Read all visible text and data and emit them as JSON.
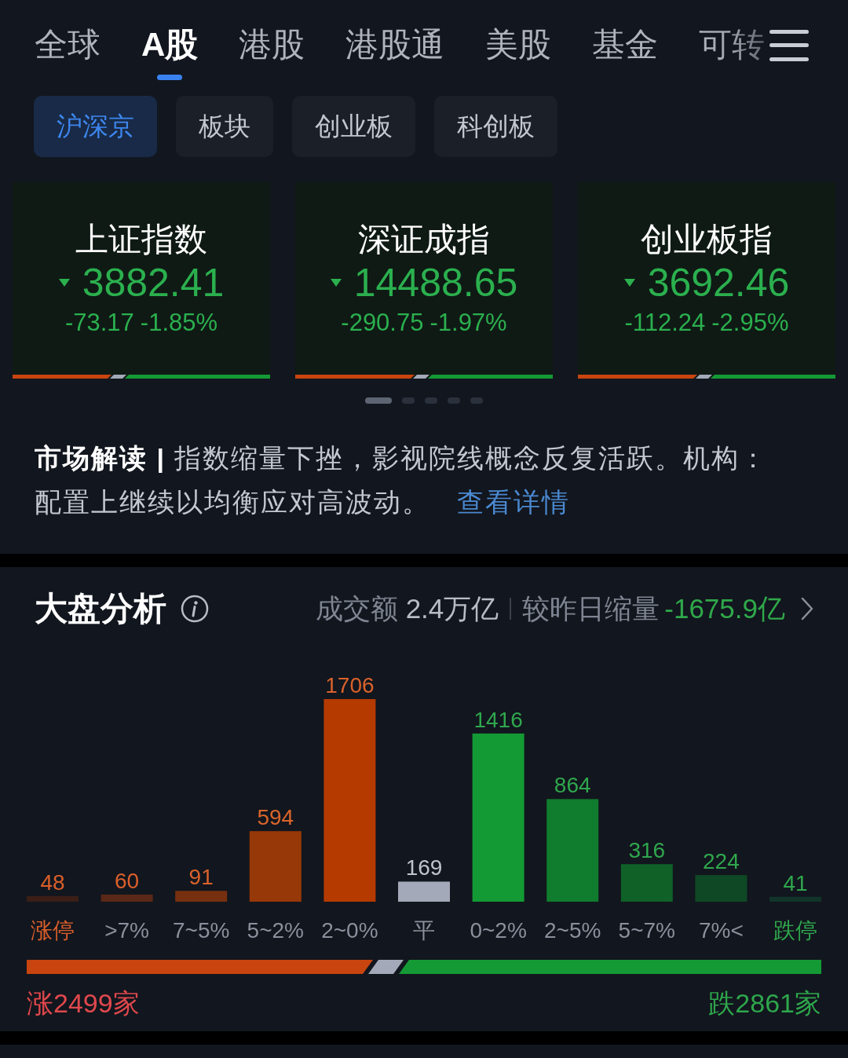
{
  "tabs": [
    {
      "label": "全球",
      "selected": false
    },
    {
      "label": "A股",
      "selected": true
    },
    {
      "label": "港股",
      "selected": false
    },
    {
      "label": "港股通",
      "selected": false
    },
    {
      "label": "美股",
      "selected": false
    },
    {
      "label": "基金",
      "selected": false
    },
    {
      "label": "可转",
      "selected": false
    }
  ],
  "sub_tabs": [
    {
      "label": "沪深京",
      "selected": true
    },
    {
      "label": "板块",
      "selected": false
    },
    {
      "label": "创业板",
      "selected": false
    },
    {
      "label": "科创板",
      "selected": false
    }
  ],
  "indices": [
    {
      "name": "上证指数",
      "value": "3882.41",
      "change": "-73.17",
      "change_percent": "-1.85%",
      "kind": "down",
      "level": 0.41
    },
    {
      "name": "深证成指",
      "value": "14488.65",
      "change": "-290.75",
      "change_percent": "-1.97%",
      "kind": "down",
      "level": 0.49
    },
    {
      "name": "创业板指",
      "value": "3692.46",
      "change": "-112.24",
      "change_percent": "-2.95%",
      "kind": "down",
      "level": 0.49
    }
  ],
  "pager": [
    {
      "selected": true
    },
    {
      "selected": false
    },
    {
      "selected": false
    },
    {
      "selected": false
    },
    {
      "selected": false
    }
  ],
  "commentary": {
    "text": "**市场解读 |** 指数缩量下挫，影视院线概念反复活跃。机构：配置上继续以均衡应对高波动。",
    "link": "查看详情"
  },
  "market_analysis": {
    "title": "大盘分析",
    "turnover_label": "成交额",
    "turnover": "2.4万亿",
    "comparison_label": "较昨日缩量",
    "comparison": "-1675.9亿",
    "chart_data": {
      "type": "bar",
      "categories": [
        "涨停",
        ">7%",
        "7~5%",
        "5~2%",
        "2~0%",
        "平",
        "0~2%",
        "2~5%",
        "5~7%",
        "7%<",
        "跌停"
      ],
      "values": [
        48,
        60,
        91,
        594,
        1706,
        169,
        1416,
        864,
        316,
        224,
        41
      ],
      "data_labels": true,
      "colors": [
        "#3a1e17",
        "#5a2816",
        "#77300f",
        "#963808",
        "#b53a00",
        "#a3a9b8",
        "#149a35",
        "#107c2e",
        "#0f6128",
        "#0f4824",
        "#11352a"
      ]
    },
    "breadth": {
      "level": 0.452,
      "rise_label": "涨2499家",
      "fall_label": "跌2861家"
    }
  }
}
